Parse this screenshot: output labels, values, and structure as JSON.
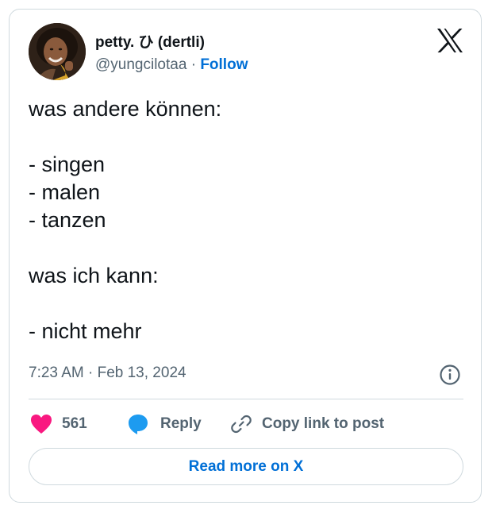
{
  "author": {
    "display_name": "petty. ひ (dertli)",
    "handle": "@yungcilotaa",
    "separator": "·",
    "follow_label": "Follow"
  },
  "brand": {
    "icon": "x-logo-icon"
  },
  "tweet": {
    "text": "was andere können:\n\n- singen\n- malen\n- tanzen\n\nwas ich kann:\n\n- nicht mehr",
    "time": "7:23 AM · Feb 13, 2024"
  },
  "actions": {
    "like_count": "561",
    "reply_label": "Reply",
    "copy_label": "Copy link to post"
  },
  "read_more_label": "Read more on X",
  "colors": {
    "accent": "#006fd6",
    "heart": "#f91880",
    "reply_bubble": "#1d9bf0",
    "muted_text": "#536471",
    "border": "#cfd9de"
  }
}
